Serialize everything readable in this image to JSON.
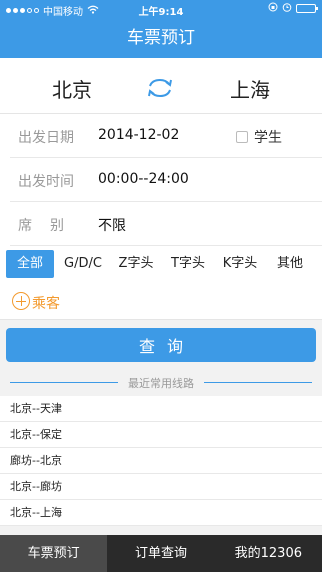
{
  "status": {
    "carrier": "中国移动",
    "time": "上午9:14",
    "battery_level": 0.9
  },
  "nav": {
    "title": "车票预订"
  },
  "route": {
    "from": "北京",
    "to": "上海",
    "swap_icon": "swap-arrows-icon"
  },
  "departure_date": {
    "label": "出发日期",
    "value": "2014-12-02",
    "student_label": "学生"
  },
  "departure_time": {
    "label": "出发时间",
    "value": "00:00--24:00"
  },
  "seat": {
    "label": "席别",
    "value": "不限"
  },
  "train_types": [
    "全部",
    "G/D/C",
    "Z字头",
    "T字头",
    "K字头",
    "其他"
  ],
  "passenger": {
    "label": "乘客"
  },
  "query_button": "查询",
  "recent": {
    "title": "最近常用线路",
    "items": [
      "北京--天津",
      "北京--保定",
      "廊坊--北京",
      "北京--廊坊",
      "北京--上海"
    ]
  },
  "tabs": [
    "车票预订",
    "订单查询",
    "我的12306"
  ],
  "colors": {
    "primary": "#3d9ae6",
    "accent": "#f39a2e",
    "tab_bar": "#2a2a2a"
  }
}
